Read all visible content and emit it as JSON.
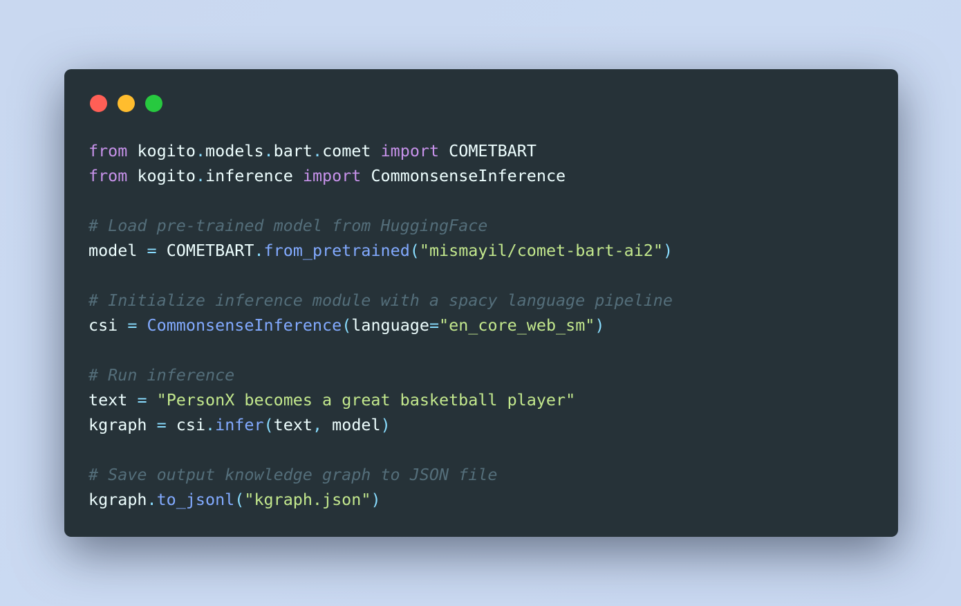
{
  "colors": {
    "window_bg": "#263238",
    "close": "#ff5f56",
    "minimize": "#ffbd2e",
    "zoom": "#27c93f"
  },
  "code_lines": [
    [
      {
        "t": "from",
        "c": "keyword"
      },
      {
        "t": " ",
        "c": "space"
      },
      {
        "t": "kogito",
        "c": "ident"
      },
      {
        "t": ".",
        "c": "dot"
      },
      {
        "t": "models",
        "c": "ident"
      },
      {
        "t": ".",
        "c": "dot"
      },
      {
        "t": "bart",
        "c": "ident"
      },
      {
        "t": ".",
        "c": "dot"
      },
      {
        "t": "comet",
        "c": "ident"
      },
      {
        "t": " ",
        "c": "space"
      },
      {
        "t": "import",
        "c": "keyword"
      },
      {
        "t": " ",
        "c": "space"
      },
      {
        "t": "COMETBART",
        "c": "ident"
      }
    ],
    [
      {
        "t": "from",
        "c": "keyword"
      },
      {
        "t": " ",
        "c": "space"
      },
      {
        "t": "kogito",
        "c": "ident"
      },
      {
        "t": ".",
        "c": "dot"
      },
      {
        "t": "inference",
        "c": "ident"
      },
      {
        "t": " ",
        "c": "space"
      },
      {
        "t": "import",
        "c": "keyword"
      },
      {
        "t": " ",
        "c": "space"
      },
      {
        "t": "CommonsenseInference",
        "c": "ident"
      }
    ],
    [],
    [
      {
        "t": "# Load pre-trained model from HuggingFace",
        "c": "comment"
      }
    ],
    [
      {
        "t": "model",
        "c": "ident"
      },
      {
        "t": " ",
        "c": "space"
      },
      {
        "t": "=",
        "c": "op"
      },
      {
        "t": " ",
        "c": "space"
      },
      {
        "t": "COMETBART",
        "c": "ident"
      },
      {
        "t": ".",
        "c": "dot"
      },
      {
        "t": "from_pretrained",
        "c": "func"
      },
      {
        "t": "(",
        "c": "punct"
      },
      {
        "t": "\"mismayil/comet-bart-ai2\"",
        "c": "string"
      },
      {
        "t": ")",
        "c": "punct"
      }
    ],
    [],
    [
      {
        "t": "# Initialize inference module with a spacy language pipeline",
        "c": "comment"
      }
    ],
    [
      {
        "t": "csi",
        "c": "ident"
      },
      {
        "t": " ",
        "c": "space"
      },
      {
        "t": "=",
        "c": "op"
      },
      {
        "t": " ",
        "c": "space"
      },
      {
        "t": "CommonsenseInference",
        "c": "func"
      },
      {
        "t": "(",
        "c": "punct"
      },
      {
        "t": "language",
        "c": "ident"
      },
      {
        "t": "=",
        "c": "op"
      },
      {
        "t": "\"en_core_web_sm\"",
        "c": "string"
      },
      {
        "t": ")",
        "c": "punct"
      }
    ],
    [],
    [
      {
        "t": "# Run inference",
        "c": "comment"
      }
    ],
    [
      {
        "t": "text",
        "c": "ident"
      },
      {
        "t": " ",
        "c": "space"
      },
      {
        "t": "=",
        "c": "op"
      },
      {
        "t": " ",
        "c": "space"
      },
      {
        "t": "\"PersonX becomes a great basketball player\"",
        "c": "string"
      }
    ],
    [
      {
        "t": "kgraph",
        "c": "ident"
      },
      {
        "t": " ",
        "c": "space"
      },
      {
        "t": "=",
        "c": "op"
      },
      {
        "t": " ",
        "c": "space"
      },
      {
        "t": "csi",
        "c": "ident"
      },
      {
        "t": ".",
        "c": "dot"
      },
      {
        "t": "infer",
        "c": "func"
      },
      {
        "t": "(",
        "c": "punct"
      },
      {
        "t": "text",
        "c": "ident"
      },
      {
        "t": ",",
        "c": "punct"
      },
      {
        "t": " ",
        "c": "space"
      },
      {
        "t": "model",
        "c": "ident"
      },
      {
        "t": ")",
        "c": "punct"
      }
    ],
    [],
    [
      {
        "t": "# Save output knowledge graph to JSON file",
        "c": "comment"
      }
    ],
    [
      {
        "t": "kgraph",
        "c": "ident"
      },
      {
        "t": ".",
        "c": "dot"
      },
      {
        "t": "to_jsonl",
        "c": "func"
      },
      {
        "t": "(",
        "c": "punct"
      },
      {
        "t": "\"kgraph.json\"",
        "c": "string"
      },
      {
        "t": ")",
        "c": "punct"
      }
    ]
  ]
}
